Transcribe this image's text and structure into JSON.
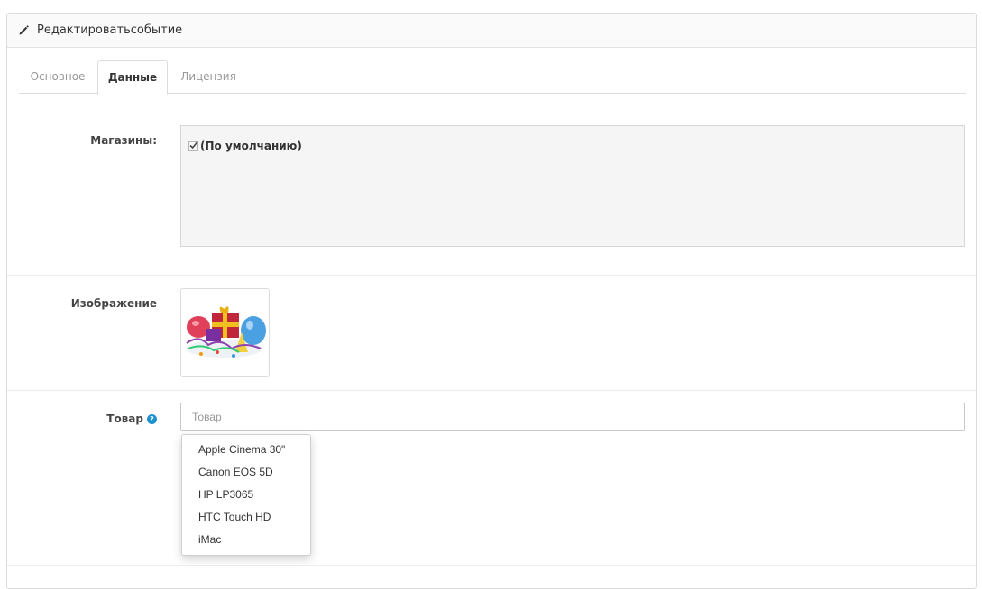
{
  "header": {
    "title": "Редактироватьсобытие",
    "icon": "pencil-icon"
  },
  "tabs": [
    {
      "label": "Основное",
      "active": false
    },
    {
      "label": "Данные",
      "active": true
    },
    {
      "label": "Лицензия",
      "active": false
    }
  ],
  "stores": {
    "label": "Магазины:",
    "items": [
      {
        "label": "(По умолчанию)",
        "checked": true
      }
    ]
  },
  "image": {
    "label": "Изображение"
  },
  "product": {
    "label": "Товар",
    "placeholder": "Товар",
    "value": "",
    "help_icon": "question-circle-icon",
    "suggestions": [
      "Apple Cinema 30\"",
      "Canon EOS 5D",
      "HP LP3065",
      "HTC Touch HD",
      "iMac"
    ]
  },
  "colors": {
    "accent": "#1e91cf",
    "heading_bg": "#fafafa",
    "stores_bg": "#f5f5f5"
  }
}
